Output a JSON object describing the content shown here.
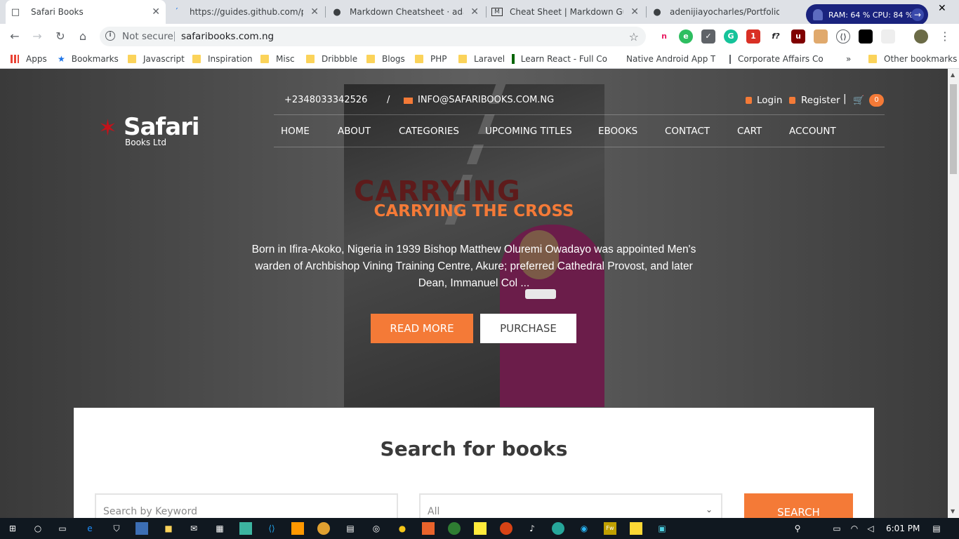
{
  "browser": {
    "tabs": [
      {
        "title": "Safari Books",
        "icon": "page-icon"
      },
      {
        "title": "https://guides.github.com/pdfs/markdown-cheatsheet-online.pdf",
        "icon": "loading-icon"
      },
      {
        "title": "Markdown Cheatsheet · adam-p/markdown-here Wiki",
        "icon": "github-icon"
      },
      {
        "title": "Cheat Sheet | Markdown Guide",
        "icon": "markdown-icon"
      },
      {
        "title": "adenijiayocharles/Portfolio: Lis",
        "icon": "github-icon"
      }
    ],
    "ram_cpu": "RAM: 64 %  CPU: 84 %",
    "omnibox": {
      "security": "Not secure",
      "url": "safaribooks.com.ng"
    },
    "bookmarks": [
      "Apps",
      "Bookmarks",
      "Javascript",
      "Inspiration",
      "Misc",
      "Dribbble",
      "Blogs",
      "PHP",
      "Laravel",
      "Learn React - Full Co",
      "Native Android App T",
      "Corporate Affairs Cor",
      "»",
      "Other bookmarks"
    ]
  },
  "site": {
    "phone": "+2348033342526",
    "separator": "/",
    "email": "INFO@SAFARIBOOKS.COM.NG",
    "login": "Login",
    "register": "Register",
    "pipe": "|",
    "cart_count": "0",
    "logo": {
      "name": "Safari",
      "sub": "Books Ltd"
    },
    "nav": [
      "HOME",
      "ABOUT",
      "CATEGORIES",
      "UPCOMING TITLES",
      "EBOOKS",
      "CONTACT",
      "CART",
      "ACCOUNT"
    ],
    "hero": {
      "cover_title": "CARRYING",
      "title": "CARRYING THE CROSS",
      "text": "Born in Ifira-Akoko, Nigeria in 1939 Bishop Matthew Oluremi Owadayo was appointed Men's warden of Archbishop Vining Training Centre, Akure; preferred Cathedral Provost, and later Dean, Immanuel Col ...",
      "read_more": "READ MORE",
      "purchase": "PURCHASE"
    },
    "search": {
      "heading": "Search for books",
      "keyword_placeholder": "Search by Keyword",
      "category_value": "All",
      "button": "SEARCH"
    }
  },
  "taskbar": {
    "time": "6:01 PM"
  },
  "colors": {
    "accent": "#f47a37",
    "logo_red": "#c4121a"
  }
}
